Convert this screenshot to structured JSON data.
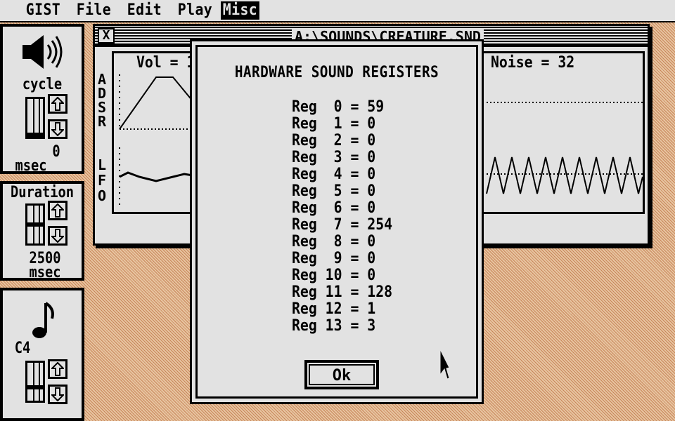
{
  "menubar": {
    "items": [
      {
        "label": "GIST",
        "active": false
      },
      {
        "label": "File",
        "active": false
      },
      {
        "label": "Edit",
        "active": false
      },
      {
        "label": "Play",
        "active": false
      },
      {
        "label": "Misc",
        "active": true
      }
    ]
  },
  "panels": {
    "cycle": {
      "icon": "speaker-icon",
      "label": "cycle",
      "value": "0",
      "unit": "msec"
    },
    "duration": {
      "label": "Duration",
      "value": "2500",
      "unit": "msec"
    },
    "pitch": {
      "icon": "music-note-icon",
      "label": "C4"
    }
  },
  "window": {
    "title": "A:\\SOUNDS\\CREATURE.SND",
    "close_label": "X",
    "vol_label": "Vol = 1",
    "noise_label": "Noise = 32",
    "adsr_letters": [
      "A",
      "D",
      "S",
      "R"
    ],
    "lfo_letters": [
      "L",
      "F",
      "O"
    ]
  },
  "dialog": {
    "title": "HARDWARE SOUND REGISTERS",
    "registers": [
      {
        "label": "Reg  0",
        "value": "59"
      },
      {
        "label": "Reg  1",
        "value": "0"
      },
      {
        "label": "Reg  2",
        "value": "0"
      },
      {
        "label": "Reg  3",
        "value": "0"
      },
      {
        "label": "Reg  4",
        "value": "0"
      },
      {
        "label": "Reg  5",
        "value": "0"
      },
      {
        "label": "Reg  6",
        "value": "0"
      },
      {
        "label": "Reg  7",
        "value": "254"
      },
      {
        "label": "Reg  8",
        "value": "0"
      },
      {
        "label": "Reg  9",
        "value": "0"
      },
      {
        "label": "Reg 10",
        "value": "0"
      },
      {
        "label": "Reg 11",
        "value": "128"
      },
      {
        "label": "Reg 12",
        "value": "1"
      },
      {
        "label": "Reg 13",
        "value": "3"
      }
    ],
    "ok_label": "Ok"
  },
  "colors": {
    "desktop": "#d5a276",
    "window_bg": "#e2e2e2",
    "ink": "#000000"
  }
}
